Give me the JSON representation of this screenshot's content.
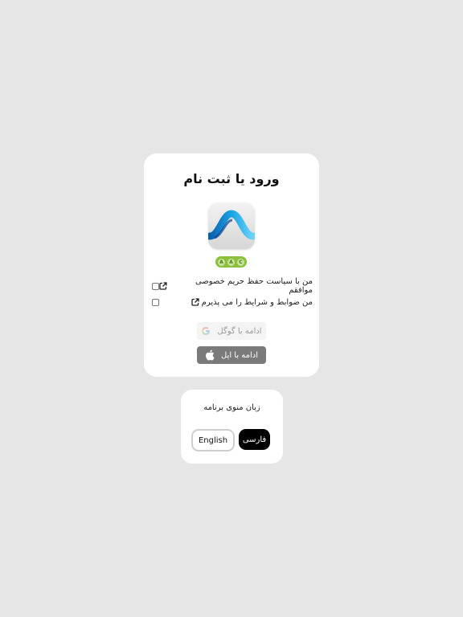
{
  "auth": {
    "title": "ورود یا ثبت نام",
    "badge_letters": [
      "A",
      "A",
      "C"
    ],
    "privacy_label": "من با سیاست حفظ حریم خصوصی موافقم",
    "terms_label": "من ضوابط و شرایط را می پذیرم",
    "google_label": "ادامه با گوگل",
    "apple_label": "ادامه با اپل",
    "icons": {
      "privacy_link": "external-link-icon",
      "terms_link": "external-link-icon",
      "google": "google-icon",
      "apple": "apple-icon"
    }
  },
  "language": {
    "title": "زبان منوی برنامه",
    "english_label": "English",
    "farsi_label": "فارسی",
    "selected": "فارسی"
  },
  "colors": {
    "background": "#e6e6e6",
    "card": "#ffffff",
    "selected_language": "#000000",
    "apple_button": "#7a7a7a",
    "google_button": "#f4f4f4",
    "badge": "#8bbf3c",
    "logo_accent": "#1aa0e0"
  }
}
